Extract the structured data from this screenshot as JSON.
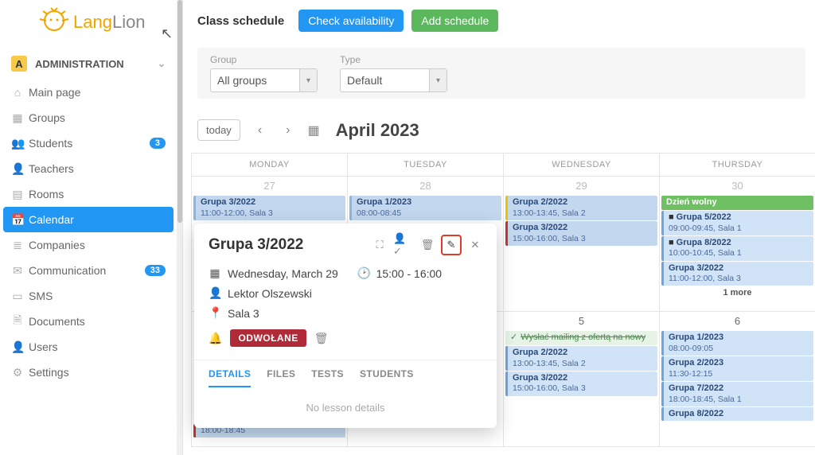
{
  "logo": {
    "main": "Lang",
    "suffix": "Lion"
  },
  "sidebar": {
    "section": "ADMINISTRATION",
    "badge_letter": "A",
    "items": [
      {
        "label": "Main page",
        "icon": "⌂"
      },
      {
        "label": "Groups",
        "icon": "▦"
      },
      {
        "label": "Students",
        "icon": "👥",
        "badge": "3"
      },
      {
        "label": "Teachers",
        "icon": "👤"
      },
      {
        "label": "Rooms",
        "icon": "▤"
      },
      {
        "label": "Calendar",
        "icon": "📅",
        "active": true
      },
      {
        "label": "Companies",
        "icon": "≣"
      },
      {
        "label": "Communication",
        "icon": "✉",
        "badge": "33"
      },
      {
        "label": "SMS",
        "icon": "▭"
      },
      {
        "label": "Documents",
        "icon": "🗎"
      },
      {
        "label": "Users",
        "icon": "👤"
      },
      {
        "label": "Settings",
        "icon": "⚙"
      }
    ]
  },
  "header": {
    "title": "Class schedule",
    "check_btn": "Check availability",
    "add_btn": "Add schedule"
  },
  "filters": {
    "group_label": "Group",
    "group_value": "All groups",
    "type_label": "Type",
    "type_value": "Default"
  },
  "toolbar": {
    "today": "today",
    "month": "April 2023"
  },
  "calendar": {
    "days": [
      "MONDAY",
      "TUESDAY",
      "WEDNESDAY",
      "THURSDAY"
    ],
    "row0": {
      "dates": [
        "27",
        "28",
        "29",
        "30"
      ],
      "mon": [
        {
          "title": "Grupa 3/2022",
          "sub": "11:00-12:00, Sala 3"
        }
      ],
      "tue": [
        {
          "title": "Grupa 1/2023",
          "sub": "08:00-08:45"
        }
      ],
      "wed": [
        {
          "title": "Grupa 2/2022",
          "sub": "13:00-13:45, Sala 2"
        },
        {
          "title": "Grupa 3/2022",
          "sub": "15:00-16:00, Sala 3"
        }
      ],
      "thu": [
        {
          "title": "Dzień wolny"
        },
        {
          "title": "Grupa 5/2022",
          "sub": "09:00-09:45, Sala 1",
          "cam": true
        },
        {
          "title": "Grupa 8/2022",
          "sub": "10:00-10:45, Sala 1",
          "cam": true
        },
        {
          "title": "Grupa 3/2022",
          "sub": "11:00-12:00, Sala 3"
        }
      ],
      "thu_more": "1 more"
    },
    "row1": {
      "dates": [
        "",
        "",
        "5",
        "6"
      ],
      "wed_task": "Wysłać mailing z ofertą na nowy",
      "wed": [
        {
          "title": "Grupa 2/2022",
          "sub": "13:00-13:45, Sala 2"
        },
        {
          "title": "Grupa 3/2022",
          "sub": "15:00-16:00, Sala 3"
        }
      ],
      "thu": [
        {
          "title": "Grupa 1/2023",
          "sub": "08:00-09:05"
        },
        {
          "title": "Grupa 2/2023",
          "sub": "11:30-12:15"
        },
        {
          "title": "Grupa 7/2022",
          "sub": "18:00-18:45, Sala 1"
        },
        {
          "title": "Grupa 8/2022"
        }
      ],
      "mon_peek": {
        "sub": "18:00-18:45"
      }
    }
  },
  "popup": {
    "title": "Grupa 3/2022",
    "date": "Wednesday, March 29",
    "time": "15:00 - 16:00",
    "teacher": "Lektor Olszewski",
    "room": "Sala 3",
    "status": "ODWOŁANE",
    "tabs": [
      "DETAILS",
      "FILES",
      "TESTS",
      "STUDENTS"
    ],
    "empty": "No lesson details"
  }
}
